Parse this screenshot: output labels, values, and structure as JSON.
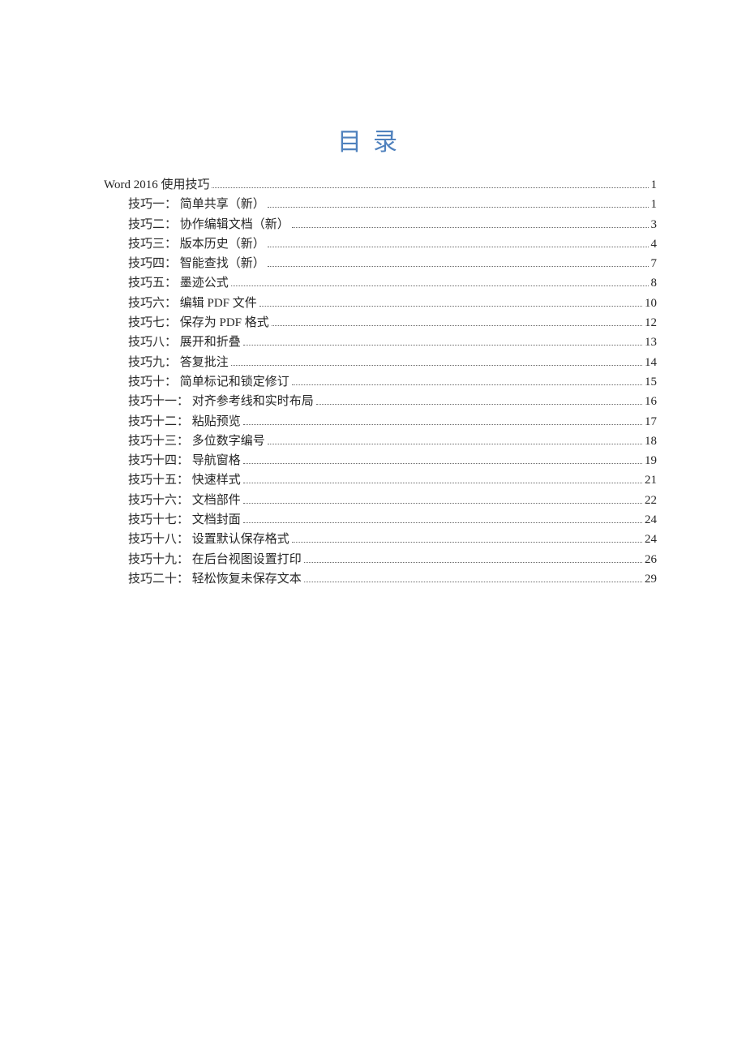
{
  "toc": {
    "title": "目录",
    "entries": [
      {
        "level": 1,
        "label": "Word 2016 使用技巧",
        "page": "1"
      },
      {
        "level": 2,
        "label": "技巧一： 简单共享（新）",
        "page": "1"
      },
      {
        "level": 2,
        "label": "技巧二： 协作编辑文档（新）",
        "page": "3"
      },
      {
        "level": 2,
        "label": "技巧三： 版本历史（新）",
        "page": "4"
      },
      {
        "level": 2,
        "label": "技巧四： 智能查找（新）",
        "page": "7"
      },
      {
        "level": 2,
        "label": "技巧五： 墨迹公式",
        "page": "8"
      },
      {
        "level": 2,
        "label": "技巧六： 编辑 PDF 文件",
        "page": "10"
      },
      {
        "level": 2,
        "label": "技巧七： 保存为 PDF 格式",
        "page": "12"
      },
      {
        "level": 2,
        "label": "技巧八： 展开和折叠",
        "page": "13"
      },
      {
        "level": 2,
        "label": "技巧九： 答复批注",
        "page": "14"
      },
      {
        "level": 2,
        "label": "技巧十： 简单标记和锁定修订",
        "page": "15"
      },
      {
        "level": 2,
        "label": "技巧十一： 对齐参考线和实时布局",
        "page": "16"
      },
      {
        "level": 2,
        "label": "技巧十二： 粘贴预览",
        "page": "17"
      },
      {
        "level": 2,
        "label": "技巧十三： 多位数字编号",
        "page": "18"
      },
      {
        "level": 2,
        "label": "技巧十四： 导航窗格",
        "page": "19"
      },
      {
        "level": 2,
        "label": "技巧十五： 快速样式",
        "page": "21"
      },
      {
        "level": 2,
        "label": "技巧十六： 文档部件",
        "page": "22"
      },
      {
        "level": 2,
        "label": "技巧十七： 文档封面",
        "page": "24"
      },
      {
        "level": 2,
        "label": "技巧十八： 设置默认保存格式",
        "page": "24"
      },
      {
        "level": 2,
        "label": "技巧十九： 在后台视图设置打印",
        "page": "26"
      },
      {
        "level": 2,
        "label": "技巧二十： 轻松恢复未保存文本",
        "page": "29"
      }
    ]
  }
}
